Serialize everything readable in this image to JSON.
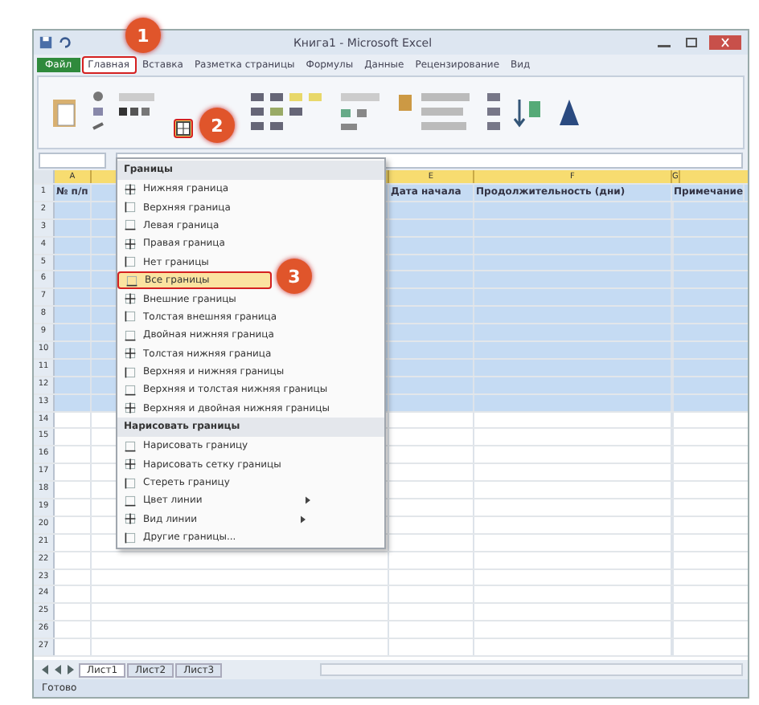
{
  "window": {
    "title": "Книга1 - Microsoft Excel"
  },
  "ribbon_tabs": [
    {
      "label": "Файл",
      "selected": false,
      "kind": "file"
    },
    {
      "label": "Главная",
      "selected": true,
      "kind": "tab"
    },
    {
      "label": "Вставка",
      "selected": false,
      "kind": "tab"
    },
    {
      "label": "Разметка страницы",
      "selected": false,
      "kind": "tab"
    },
    {
      "label": "Формулы",
      "selected": false,
      "kind": "tab"
    },
    {
      "label": "Данные",
      "selected": false,
      "kind": "tab"
    },
    {
      "label": "Рецензирование",
      "selected": false,
      "kind": "tab"
    },
    {
      "label": "Вид",
      "selected": false,
      "kind": "tab"
    }
  ],
  "callouts": [
    {
      "number": "1"
    },
    {
      "number": "2"
    },
    {
      "number": "3"
    }
  ],
  "table": {
    "columns": [
      {
        "letter": "A",
        "header": "№ п/п"
      },
      {
        "letter": "E",
        "header": "Дата начала"
      },
      {
        "letter": "F",
        "header": "Продолжительность (дни)"
      },
      {
        "letter": "G",
        "header": "Примечание"
      }
    ],
    "rows": [
      {
        "number": "1",
        "shaded": true
      },
      {
        "number": "2",
        "shaded": true
      },
      {
        "number": "3",
        "shaded": true
      },
      {
        "number": "4",
        "shaded": true
      },
      {
        "number": "5",
        "shaded": true
      },
      {
        "number": "6",
        "shaded": true
      },
      {
        "number": "7",
        "shaded": true
      },
      {
        "number": "8",
        "shaded": true
      },
      {
        "number": "9",
        "shaded": true
      },
      {
        "number": "10",
        "shaded": true
      },
      {
        "number": "11",
        "shaded": true
      },
      {
        "number": "12",
        "shaded": true
      },
      {
        "number": "13",
        "shaded": true
      },
      {
        "number": "14",
        "shaded": false
      },
      {
        "number": "15",
        "shaded": false
      },
      {
        "number": "16",
        "shaded": false
      },
      {
        "number": "17",
        "shaded": false
      },
      {
        "number": "18",
        "shaded": false
      },
      {
        "number": "19",
        "shaded": false
      },
      {
        "number": "20",
        "shaded": false
      },
      {
        "number": "21",
        "shaded": false
      },
      {
        "number": "22",
        "shaded": false
      },
      {
        "number": "23",
        "shaded": false
      },
      {
        "number": "24",
        "shaded": false
      },
      {
        "number": "25",
        "shaded": false
      },
      {
        "number": "26",
        "shaded": false
      },
      {
        "number": "27",
        "shaded": false
      }
    ]
  },
  "borders_menu": {
    "items": [
      {
        "kind": "header",
        "label": "Границы"
      },
      {
        "kind": "item",
        "label": "Нижняя граница",
        "selected": false
      },
      {
        "kind": "item",
        "label": "Верхняя граница",
        "selected": false
      },
      {
        "kind": "item",
        "label": "Левая граница",
        "selected": false
      },
      {
        "kind": "item",
        "label": "Правая граница",
        "selected": false
      },
      {
        "kind": "item",
        "label": "Нет границы",
        "selected": false
      },
      {
        "kind": "item",
        "label": "Все границы",
        "selected": true
      },
      {
        "kind": "item",
        "label": "Внешние границы",
        "selected": false
      },
      {
        "kind": "item",
        "label": "Толстая внешняя граница",
        "selected": false
      },
      {
        "kind": "item",
        "label": "Двойная нижняя граница",
        "selected": false
      },
      {
        "kind": "item",
        "label": "Толстая нижняя граница",
        "selected": false
      },
      {
        "kind": "item",
        "label": "Верхняя и нижняя границы",
        "selected": false
      },
      {
        "kind": "item",
        "label": "Верхняя и толстая нижняя границы",
        "selected": false
      },
      {
        "kind": "item",
        "label": "Верхняя и двойная нижняя границы",
        "selected": false
      },
      {
        "kind": "header",
        "label": "Нарисовать границы"
      },
      {
        "kind": "item",
        "label": "Нарисовать границу",
        "selected": false
      },
      {
        "kind": "item",
        "label": "Нарисовать сетку границы",
        "selected": false
      },
      {
        "kind": "item",
        "label": "Стереть границу",
        "selected": false
      },
      {
        "kind": "submenu",
        "label": "Цвет линии",
        "selected": false
      },
      {
        "kind": "submenu",
        "label": "Вид линии",
        "selected": false
      },
      {
        "kind": "item",
        "label": "Другие границы...",
        "selected": false
      }
    ]
  },
  "sheet_tabs": [
    {
      "label": "Лист1",
      "selected": true
    },
    {
      "label": "Лист2",
      "selected": false
    },
    {
      "label": "Лист3",
      "selected": false
    }
  ],
  "status_bar": {
    "text": "Готово"
  }
}
